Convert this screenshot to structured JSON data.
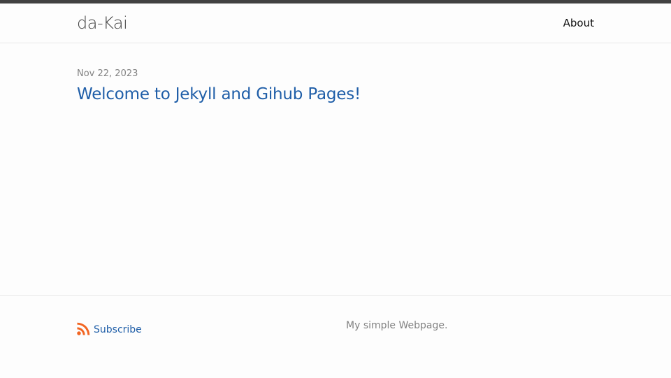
{
  "header": {
    "site_title": "da-Kai",
    "nav": [
      {
        "label": "About"
      }
    ]
  },
  "posts": [
    {
      "date": "Nov 22, 2023",
      "title": "Welcome to Jekyll and Gihub Pages!"
    }
  ],
  "footer": {
    "subscribe_label": "Subscribe",
    "description": "My simple Webpage."
  },
  "colors": {
    "link": "#1f5ea8",
    "rss": "#f26522",
    "header_border": "#424242",
    "meta_text": "#828282"
  },
  "icons": {
    "subscribe": "rss-icon"
  }
}
